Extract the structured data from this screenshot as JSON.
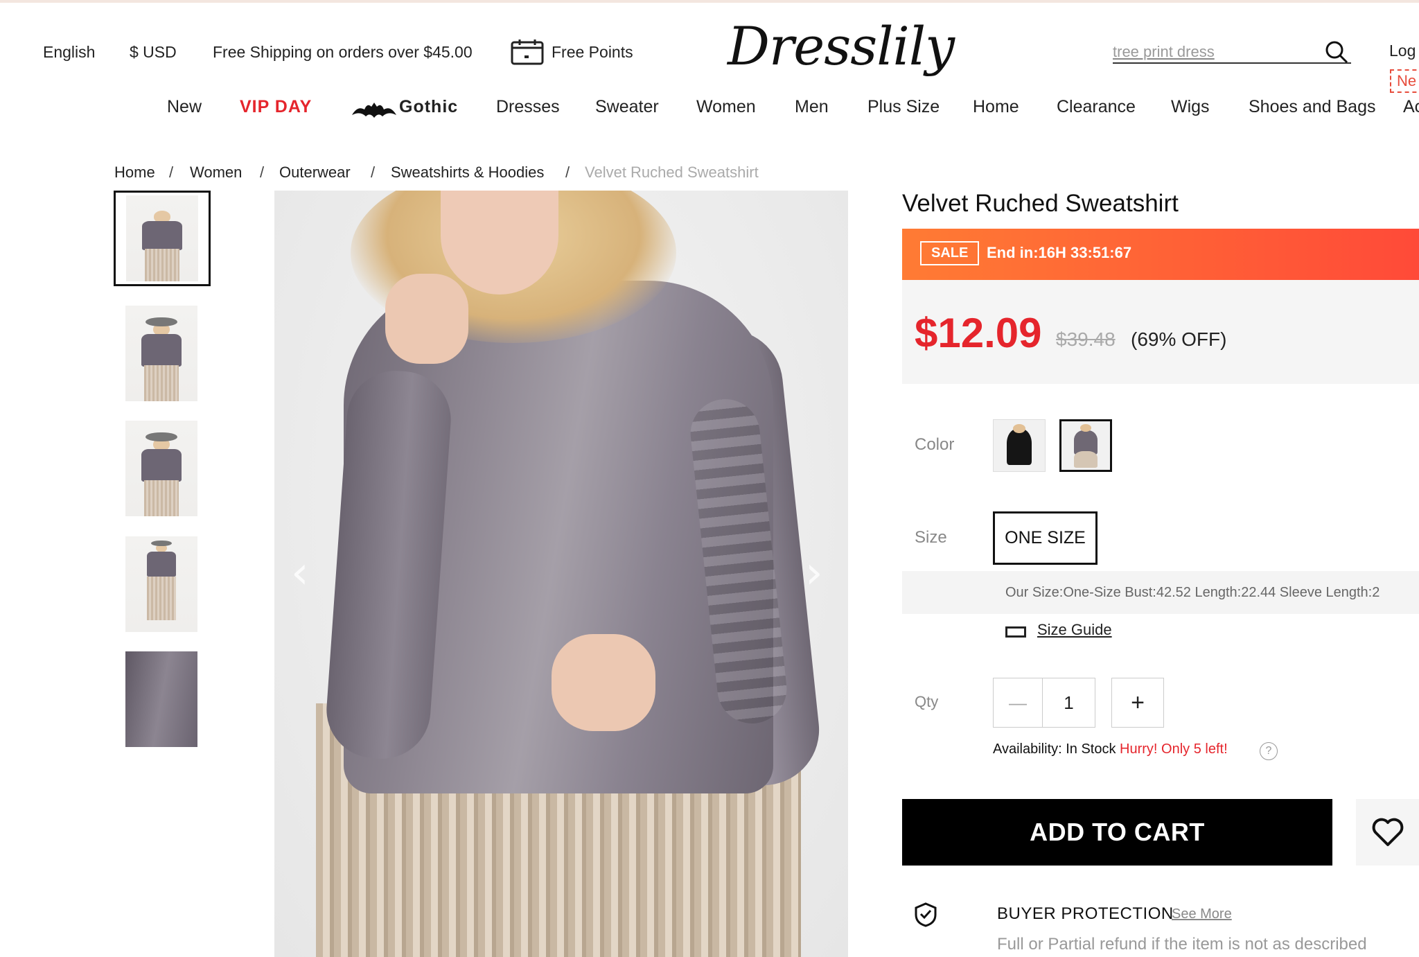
{
  "topbar": {
    "language": "English",
    "currency": "$ USD",
    "shipping": "Free Shipping on orders over $45.00",
    "points": "Free Points",
    "logo": "Dresslily",
    "search_placeholder": "tree print dress",
    "login": "Log",
    "new_badge": "Ne"
  },
  "nav": [
    "New",
    "VIP DAY",
    "Gothic",
    "Dresses",
    "Sweater",
    "Women",
    "Men",
    "Plus Size",
    "Home",
    "Clearance",
    "Wigs",
    "Shoes and Bags",
    "Ac"
  ],
  "breadcrumb": [
    "Home",
    "Women",
    "Outerwear",
    "Sweatshirts & Hoodies",
    "Velvet Ruched Sweatshirt"
  ],
  "product": {
    "title": "Velvet Ruched Sweatshirt",
    "sale_tag": "SALE",
    "countdown": "End in:16H 33:51:67",
    "price": "$12.09",
    "old_price": "$39.48",
    "discount": "(69% OFF)",
    "color_label": "Color",
    "size_label": "Size",
    "size_value": "ONE SIZE",
    "size_info": "Our Size:One-Size   Bust:42.52   Length:22.44   Sleeve Length:2",
    "size_guide": "Size Guide",
    "qty_label": "Qty",
    "qty_value": "1",
    "qty_minus": "—",
    "qty_plus": "+",
    "availability": "Availability: In Stock ",
    "hurry": "Hurry! Only 5 left!",
    "help": "?",
    "add_to_cart": "ADD TO CART",
    "buyer_protection": "BUYER PROTECTION",
    "see_more": "See More",
    "bp_text": "Full or Partial refund if the item is not as described"
  },
  "colors": {
    "accent": "#e5252c",
    "sale_gradient_start": "#ff7b34",
    "sale_gradient_end": "#ff4a38"
  },
  "icons": {
    "calendar": "calendar-icon",
    "search": "search-icon",
    "bat": "bat-icon",
    "arrow_left": "chevron-left-icon",
    "arrow_right": "chevron-right-icon",
    "ruler": "ruler-icon",
    "heart": "heart-icon",
    "shield": "shield-check-icon"
  }
}
